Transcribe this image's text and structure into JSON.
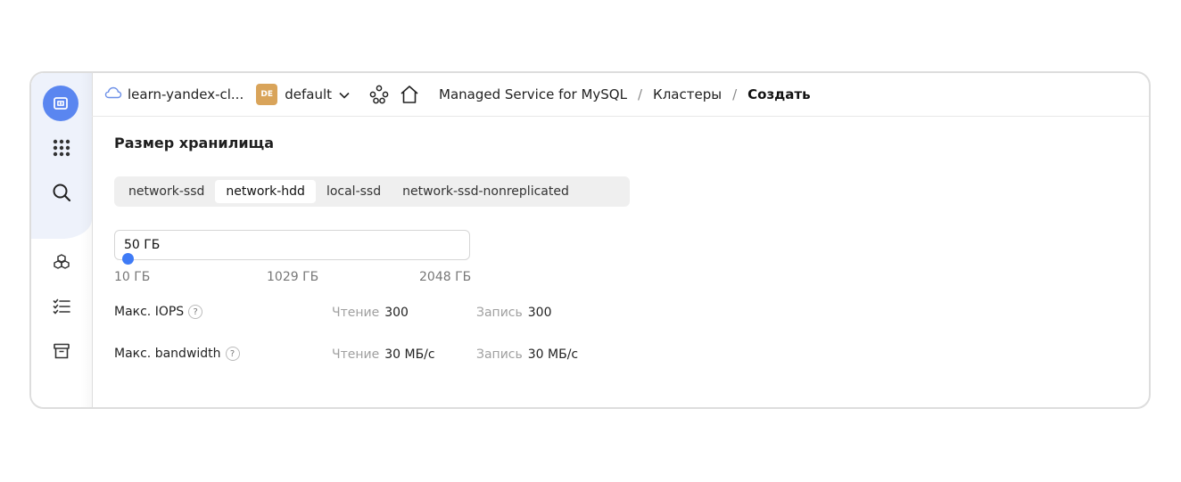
{
  "topbar": {
    "cloud_name": "learn-yandex-cl...",
    "folder_badge": "DE",
    "folder_name": "default",
    "breadcrumbs": [
      "Managed Service for MySQL",
      "Кластеры",
      "Создать"
    ],
    "separator": "/"
  },
  "storage": {
    "title": "Размер хранилища",
    "disk_types": [
      "network-ssd",
      "network-hdd",
      "local-ssd",
      "network-ssd-nonreplicated"
    ],
    "selected_disk_type": "network-hdd",
    "size_value": "50 ГБ",
    "slider_fraction": 0.0197,
    "ticks": [
      "10 ГБ",
      "1029 ГБ",
      "2048 ГБ"
    ],
    "iops": {
      "label": "Макс. IOPS",
      "help": "?",
      "read_label": "Чтение",
      "read_value": "300",
      "write_label": "Запись",
      "write_value": "300"
    },
    "bandwidth": {
      "label": "Макс. bandwidth",
      "help": "?",
      "read_label": "Чтение",
      "read_value": "30 МБ/с",
      "write_label": "Запись",
      "write_value": "30 МБ/с"
    }
  },
  "icons": [
    "logo-icon",
    "apps-grid-icon",
    "search-icon",
    "services-cubes-icon",
    "checklist-icon",
    "archive-icon",
    "cloud-icon",
    "chevron-down-icon",
    "network-nodes-icon",
    "home-icon"
  ],
  "colors": {
    "accent": "#3f7bf6",
    "logo_bg": "#5a86f0",
    "badge_bg": "#d9a45a",
    "rail_bg": "#eef2fb"
  }
}
